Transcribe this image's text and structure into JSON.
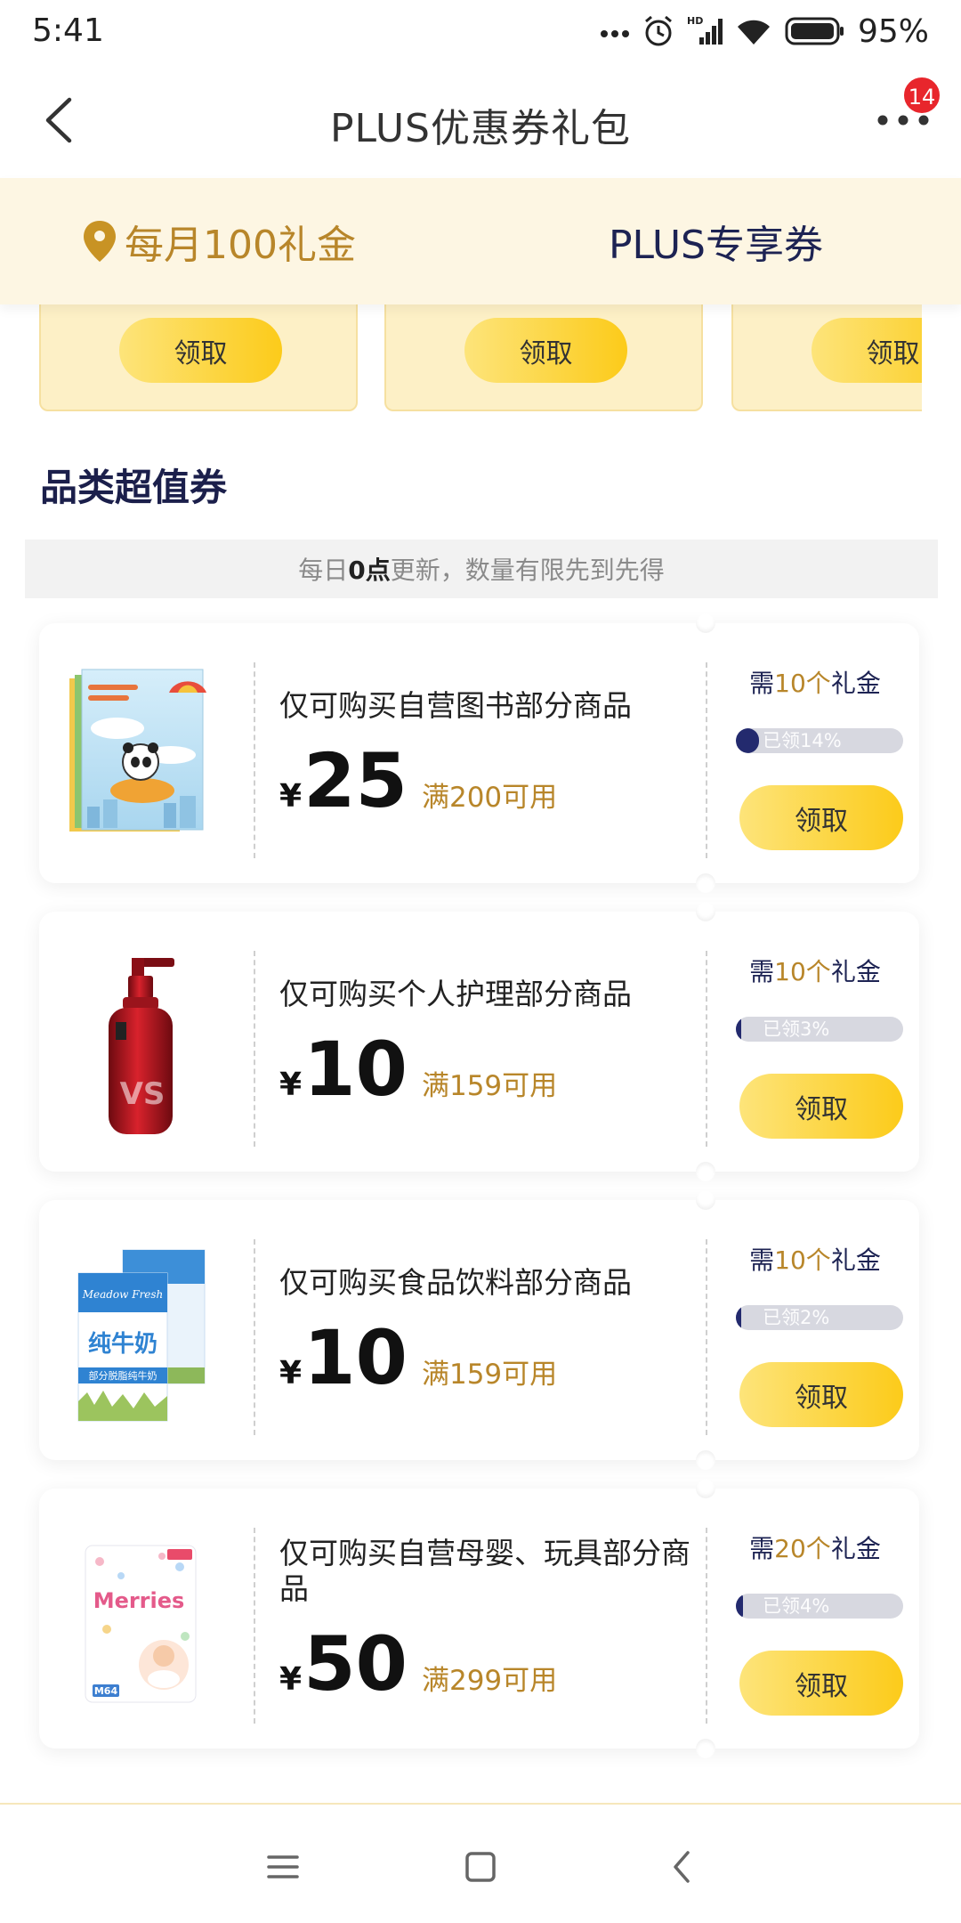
{
  "status_bar": {
    "time": "5:41",
    "battery": "95%",
    "network": "HD",
    "icons": [
      "more-dots-icon",
      "alarm-icon",
      "signal-icon",
      "wifi-icon",
      "battery-icon"
    ]
  },
  "header": {
    "title": "PLUS优惠券礼包",
    "badge": "14",
    "icons": [
      "back-icon",
      "more-icon"
    ]
  },
  "tabs": [
    {
      "label": "每月100礼金",
      "active": true,
      "icon": "location-pin-icon"
    },
    {
      "label": "PLUS专享券",
      "active": false
    }
  ],
  "top_coupons": [
    {
      "button": "领取"
    },
    {
      "button": "领取"
    },
    {
      "button": "领取"
    }
  ],
  "section_title": "品类超值券",
  "notice": {
    "prefix": "每日",
    "highlight": "0点",
    "suffix": "更新，数量有限先到先得"
  },
  "coupons": [
    {
      "image": "book-image",
      "desc": "仅可购买自营图书部分商品",
      "currency": "¥",
      "amount": "25",
      "condition": "满200可用",
      "need_prefix": "需",
      "need_amount": "10个",
      "need_suffix": "礼金",
      "progress": 14,
      "progress_label": "已领14%",
      "button": "领取"
    },
    {
      "image": "shampoo-bottle-image",
      "image_text": "VS",
      "desc": "仅可购买个人护理部分商品",
      "currency": "¥",
      "amount": "10",
      "condition": "满159可用",
      "need_prefix": "需",
      "need_amount": "10个",
      "need_suffix": "礼金",
      "progress": 3,
      "progress_label": "已领3%",
      "button": "领取"
    },
    {
      "image": "milk-box-image",
      "image_text": {
        "brand": "Meadow Fresh",
        "name": "纯牛奶",
        "sub": "部分脱脂纯牛奶"
      },
      "desc": "仅可购买食品饮料部分商品",
      "currency": "¥",
      "amount": "10",
      "condition": "满159可用",
      "need_prefix": "需",
      "need_amount": "10个",
      "need_suffix": "礼金",
      "progress": 2,
      "progress_label": "已领2%",
      "button": "领取"
    },
    {
      "image": "diaper-pack-image",
      "image_text": {
        "brand": "Merries",
        "size": "M64"
      },
      "desc": "仅可购买自营母婴、玩具部分商品",
      "currency": "¥",
      "amount": "50",
      "condition": "满299可用",
      "need_prefix": "需",
      "need_amount": "20个",
      "need_suffix": "礼金",
      "progress": 4,
      "progress_label": "已领4%",
      "button": "领取"
    }
  ],
  "bottom_nav": {
    "icons": [
      "menu-icon",
      "home-square-icon",
      "back-chevron-icon"
    ]
  },
  "colors": {
    "gold": "#b8862a",
    "navy": "#1d2353",
    "tab_bg": "#fdf6e3",
    "button_from": "#fde47a",
    "button_to": "#fccb1a",
    "progress_fill": "#232a6e",
    "badge": "#e8262c"
  }
}
